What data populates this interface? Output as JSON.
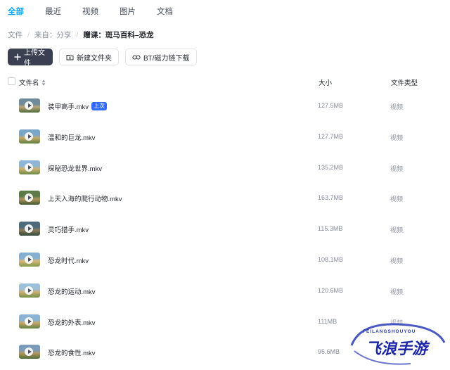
{
  "tabs": [
    "全部",
    "最近",
    "视频",
    "图片",
    "文档"
  ],
  "breadcrumb": {
    "root": "文件",
    "from": "来自：分享",
    "current": "赠课：斑马百科–恐龙"
  },
  "toolbar": {
    "upload": "上传文件",
    "new_folder": "新建文件夹",
    "bt": "BT/磁力链下载"
  },
  "table": {
    "col_name": "文件名",
    "col_size": "大小",
    "col_type": "文件类型",
    "rows": [
      {
        "name": "装甲高手.mkv",
        "badge": "上次",
        "size": "127.5MB",
        "type": "视频",
        "colors": [
          "#6f8b9a",
          "#b9a57a",
          "#4f6b3a"
        ]
      },
      {
        "name": "温和的巨龙.mkv",
        "badge": "",
        "size": "127.7MB",
        "type": "视频",
        "colors": [
          "#7aa7c8",
          "#c7a96a",
          "#5d7d3e"
        ]
      },
      {
        "name": "探秘恐龙世界.mkv",
        "badge": "",
        "size": "135.2MB",
        "type": "视频",
        "colors": [
          "#8fb6d6",
          "#d2b071",
          "#6a8b45"
        ]
      },
      {
        "name": "上天入海的爬行动物.mkv",
        "badge": "",
        "size": "163.7MB",
        "type": "视频",
        "colors": [
          "#5c7a48",
          "#b3935c",
          "#3e5a2e"
        ]
      },
      {
        "name": "灵巧猎手.mkv",
        "badge": "",
        "size": "115.3MB",
        "type": "视频",
        "colors": [
          "#4c6a7a",
          "#8c7a5a",
          "#2f4a36"
        ]
      },
      {
        "name": "恐龙时代.mkv",
        "badge": "",
        "size": "108.1MB",
        "type": "视频",
        "colors": [
          "#86b0d2",
          "#d8b877",
          "#7d9a4a"
        ]
      },
      {
        "name": "恐龙的运动.mkv",
        "badge": "",
        "size": "120.6MB",
        "type": "视频",
        "colors": [
          "#9cc0da",
          "#cfae72",
          "#6e9048"
        ]
      },
      {
        "name": "恐龙的外表.mkv",
        "badge": "",
        "size": "111MB",
        "type": "视频",
        "colors": [
          "#8bb4d4",
          "#c9a468",
          "#5f8240"
        ]
      },
      {
        "name": "恐龙的食性.mkv",
        "badge": "",
        "size": "95.6MB",
        "type": "视频",
        "colors": [
          "#7a9cb8",
          "#b8955e",
          "#4e6e36"
        ]
      }
    ]
  },
  "watermark": {
    "top": "FEILANGSHOUYOU",
    "main": "飞浪手游"
  },
  "colors": {
    "accent": "#06a7ff",
    "primary_button": "#3a3f52",
    "badge": "#2f6bff"
  }
}
